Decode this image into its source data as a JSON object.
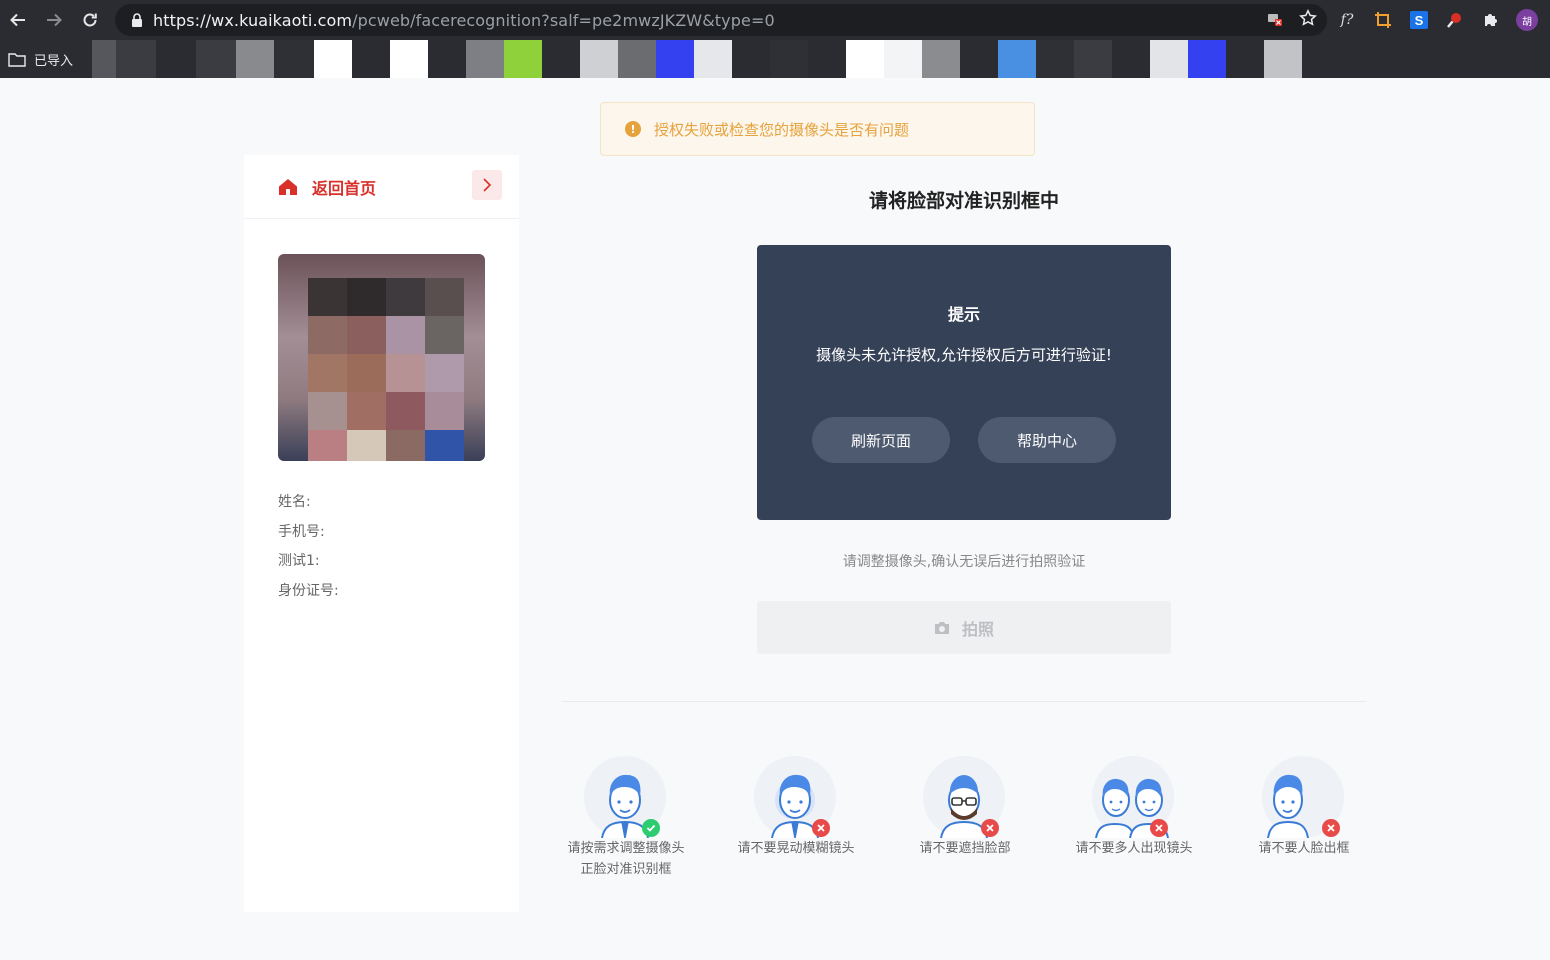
{
  "browser": {
    "url_host": "https://wx.kuaikaoti.com",
    "url_path": "/pcweb/facerecognition?salf=pe2mwzJKZW&type=0",
    "bookmark_folder": "已导入",
    "profile_initial": "胡",
    "ext_f_label": "f?"
  },
  "alert": {
    "message": "授权失败或检查您的摄像头是否有问题"
  },
  "sidebar": {
    "home_label": "返回首页",
    "fields": [
      "姓名:",
      "手机号:",
      "测试1:",
      "身份证号:"
    ]
  },
  "main": {
    "title": "请将脸部对准识别框中",
    "tip": {
      "title": "提示",
      "message": "摄像头未允许授权,允许授权后方可进行验证!",
      "refresh_button": "刷新页面",
      "help_button": "帮助中心"
    },
    "hint": "请调整摄像头,确认无误后进行拍照验证",
    "shoot_button": "拍照"
  },
  "guides": [
    {
      "line1": "请按需求调整摄像头",
      "line2": "正脸对准识别框",
      "status": "ok"
    },
    {
      "line1": "请不要晃动模糊镜头",
      "line2": "",
      "status": "error"
    },
    {
      "line1": "请不要遮挡脸部",
      "line2": "",
      "status": "error"
    },
    {
      "line1": "请不要多人出现镜头",
      "line2": "",
      "status": "error"
    },
    {
      "line1": "请不要人脸出框",
      "line2": "",
      "status": "error"
    }
  ],
  "colors": {
    "accent_red": "#d9302b",
    "warning": "#e6a23c",
    "tip_bg": "#354157",
    "ok_green": "#2ecc71",
    "error_red": "#e84a4a"
  }
}
